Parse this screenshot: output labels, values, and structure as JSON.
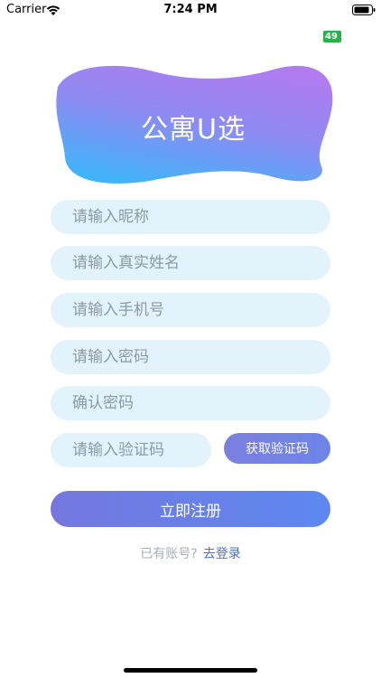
{
  "status_bar": {
    "carrier": "Carrier",
    "time": "7:24 PM"
  },
  "fps_badge": "49",
  "logo": {
    "title": "公寓U选",
    "gradient_colors": [
      "#b07cf0",
      "#3fb4fa"
    ]
  },
  "form": {
    "nickname_placeholder": "请输入昵称",
    "realname_placeholder": "请输入真实姓名",
    "phone_placeholder": "请输入手机号",
    "password_placeholder": "请输入密码",
    "confirm_placeholder": "确认密码",
    "code_placeholder": "请输入验证码",
    "get_code_label": "获取验证码",
    "register_label": "立即注册"
  },
  "login": {
    "prompt": "已有账号?",
    "link": "去登录"
  },
  "colors": {
    "input_bg": "#e3f3fc",
    "button_start": "#7478de",
    "button_end": "#5d88f0",
    "link": "#4a6fd6"
  }
}
